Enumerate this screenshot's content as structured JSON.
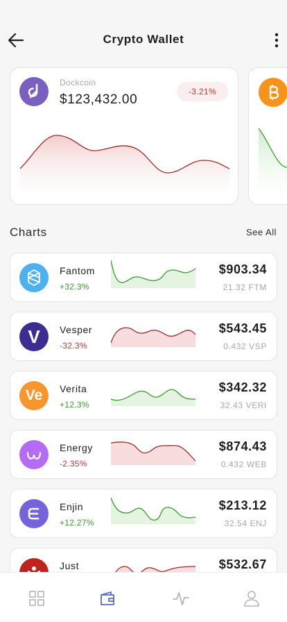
{
  "header": {
    "title": "Crypto Wallet",
    "back_icon": "arrow-left-icon",
    "menu_icon": "more-vertical-icon"
  },
  "wallet_cards": [
    {
      "coin": "Dockcoin",
      "balance": "$123,432.00",
      "change": "-3.21%",
      "trend": "down",
      "logo_color": "#7b5fc0",
      "icon": "dockcoin-icon"
    },
    {
      "coin": "",
      "logo_color": "#f7931a",
      "icon": "bitcoin-icon",
      "trend": "up"
    }
  ],
  "charts_section": {
    "title": "Charts",
    "see_all": "See All"
  },
  "coins": [
    {
      "name": "Fantom",
      "change": "+32.3%",
      "trend": "up",
      "price": "$903.34",
      "amount": "21.32 FTM",
      "logo_color": "#4cb1ee",
      "icon": "fantom-icon"
    },
    {
      "name": "Vesper",
      "change": "-32.3%",
      "trend": "down",
      "price": "$543.45",
      "amount": "0.432 VSP",
      "logo_color": "#3d2d91",
      "icon": "vesper-icon",
      "logo_text": "V"
    },
    {
      "name": "Verita",
      "change": "+12.3%",
      "trend": "up",
      "price": "$342.32",
      "amount": "32.43 VERI",
      "logo_color": "#f6962d",
      "icon": "verita-icon",
      "logo_text": "Ve"
    },
    {
      "name": "Energy",
      "change": "-2.35%",
      "trend": "down",
      "price": "$874.43",
      "amount": "0.432 WEB",
      "logo_color": "#b56cf5",
      "icon": "energy-icon"
    },
    {
      "name": "Enjin",
      "change": "+12.27%",
      "trend": "up",
      "price": "$213.12",
      "amount": "32.54 ENJ",
      "logo_color": "#7563db",
      "icon": "enjin-icon"
    },
    {
      "name": "Just",
      "change": "",
      "trend": "down",
      "price": "$532.67",
      "amount": "",
      "logo_color": "#c0221e",
      "icon": "just-icon"
    }
  ],
  "tabbar": [
    {
      "icon": "grid-icon",
      "active": false
    },
    {
      "icon": "wallet-icon",
      "active": true
    },
    {
      "icon": "activity-icon",
      "active": false
    },
    {
      "icon": "user-icon",
      "active": false
    }
  ],
  "colors": {
    "up": "#3a9a2e",
    "down": "#b33a3a",
    "active_tab": "#5b6bc6",
    "inactive_tab": "#b5b5b5"
  }
}
